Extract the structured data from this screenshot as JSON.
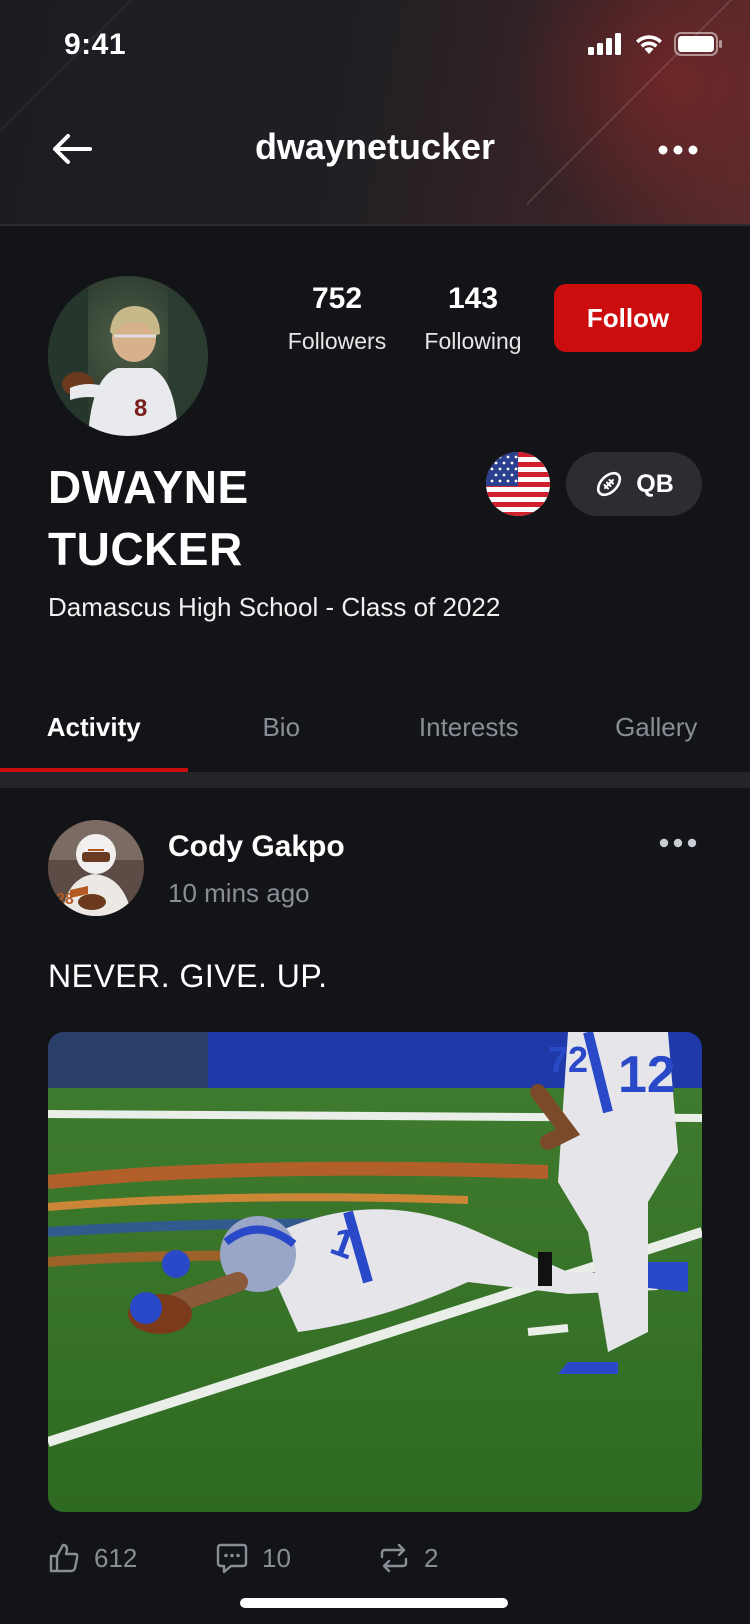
{
  "status_bar": {
    "time": "9:41"
  },
  "header": {
    "title": "dwaynetucker"
  },
  "profile": {
    "followers_count": "752",
    "followers_label": "Followers",
    "following_count": "143",
    "following_label": "Following",
    "follow_label": "Follow",
    "name_line1": "DWAYNE",
    "name_line2": "TUCKER",
    "position": "QB",
    "school": "Damascus High School - Class of 2022"
  },
  "tabs": [
    {
      "label": "Activity",
      "active": true
    },
    {
      "label": "Bio",
      "active": false
    },
    {
      "label": "Interests",
      "active": false
    },
    {
      "label": "Gallery",
      "active": false
    }
  ],
  "post": {
    "author": "Cody Gakpo",
    "time": "10 mins ago",
    "text": "NEVER. GIVE. UP.",
    "likes": "612",
    "comments": "10",
    "reposts": "2"
  },
  "colors": {
    "accent": "#cc0d0d",
    "background": "#131418",
    "muted": "#8b8d96"
  },
  "icons": {
    "back": "arrow-left-icon",
    "more": "ellipsis-icon",
    "flag": "us-flag-icon",
    "position": "football-icon",
    "like": "thumbs-up-icon",
    "comment": "comment-icon",
    "repost": "repost-icon"
  }
}
